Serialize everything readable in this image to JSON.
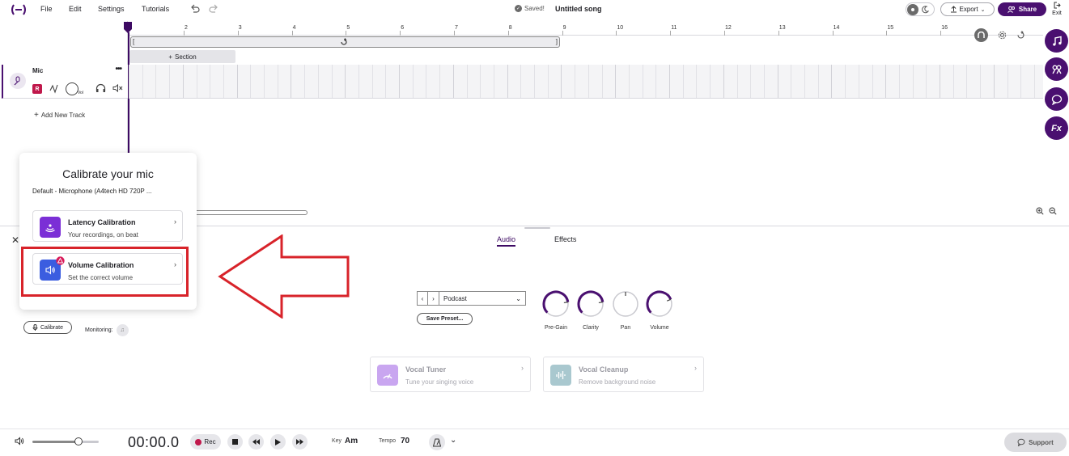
{
  "menu": {
    "file": "File",
    "edit": "Edit",
    "settings": "Settings",
    "tutorials": "Tutorials"
  },
  "status": {
    "saved": "Saved!",
    "song_title": "Untitled song"
  },
  "header_actions": {
    "export": "Export",
    "share": "Share",
    "exit": "Exit"
  },
  "ruler": {
    "ticks": [
      "2",
      "3",
      "4",
      "5",
      "6",
      "7",
      "8",
      "9",
      "10",
      "11",
      "12",
      "13",
      "14",
      "15",
      "16"
    ]
  },
  "timeline": {
    "section_label": "Section"
  },
  "track": {
    "name": "Mic",
    "rec_badge": "R",
    "vol_label": "Vol"
  },
  "add_track": "Add New Track",
  "tabs": {
    "audio": "Audio",
    "effects": "Effects"
  },
  "preset": {
    "selected": "Podcast",
    "save_label": "Save Preset..."
  },
  "knobs": [
    {
      "label": "Pre-Gain",
      "level": 0.8
    },
    {
      "label": "Clarity",
      "level": 0.8
    },
    {
      "label": "Pan",
      "level": 0.5
    },
    {
      "label": "Volume",
      "level": 0.75
    }
  ],
  "effects_cards": {
    "vocal_tuner": {
      "title": "Vocal Tuner",
      "subtitle": "Tune your singing voice"
    },
    "vocal_cleanup": {
      "title": "Vocal Cleanup",
      "subtitle": "Remove background noise"
    }
  },
  "input_controls": {
    "calibrate": "Calibrate",
    "monitoring": "Monitoring:"
  },
  "transport": {
    "time": "00:00.0",
    "rec": "Rec",
    "key_label": "Key",
    "key_value": "Am",
    "tempo_label": "Tempo",
    "tempo_value": "70",
    "volume_level": 0.7
  },
  "support": "Support",
  "calibration_popup": {
    "title": "Calibrate your mic",
    "device": "Default - Microphone (A4tech HD 720P ...",
    "latency": {
      "title": "Latency Calibration",
      "subtitle": "Your recordings, on beat"
    },
    "volume": {
      "title": "Volume Calibration",
      "subtitle": "Set the correct volume"
    }
  },
  "colors": {
    "brand": "#4a1070",
    "rec": "#c0184b",
    "highlight": "#d8232a",
    "latency_icon": "#7b2fd6",
    "volume_icon": "#3b5de0"
  }
}
